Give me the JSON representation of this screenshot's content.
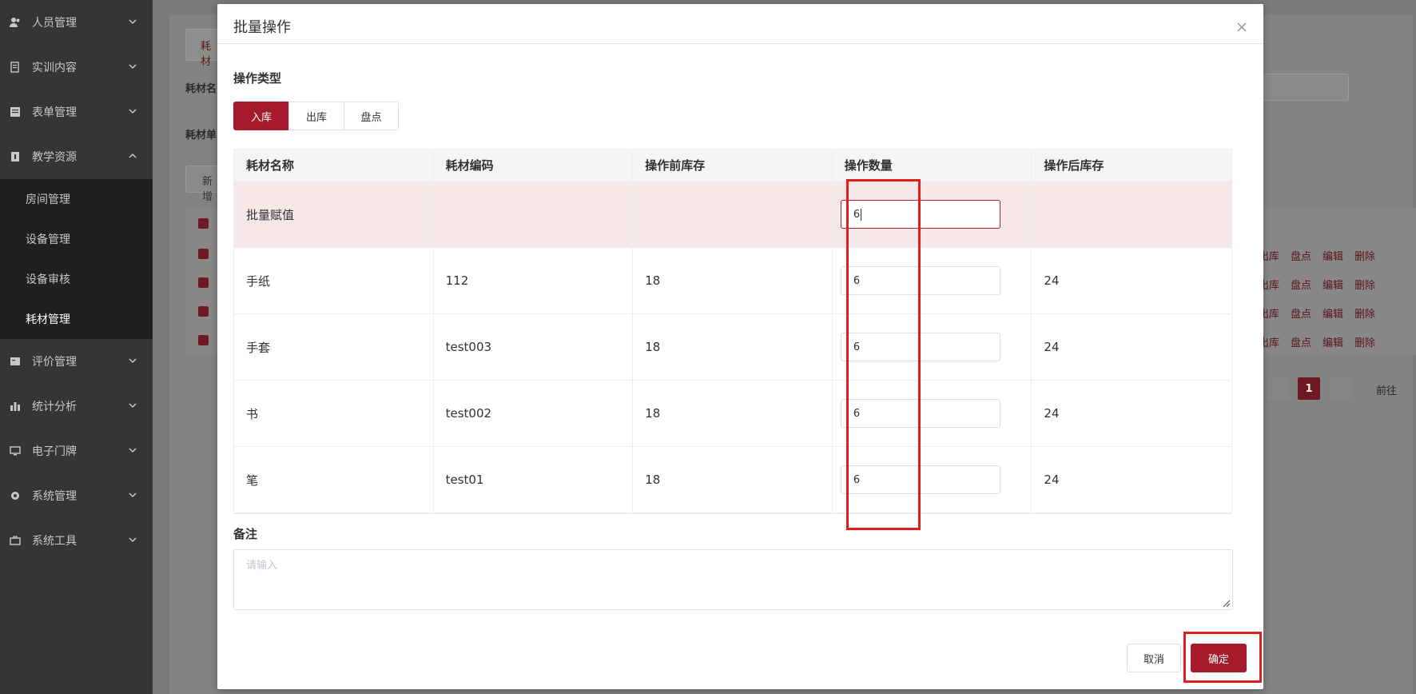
{
  "sidebar": {
    "items": [
      {
        "label": "人员管理",
        "icon": "user-icon"
      },
      {
        "label": "实训内容",
        "icon": "book-icon"
      },
      {
        "label": "表单管理",
        "icon": "form-icon"
      },
      {
        "label": "教学资源",
        "icon": "resource-icon"
      },
      {
        "label": "评价管理",
        "icon": "evaluate-icon"
      },
      {
        "label": "统计分析",
        "icon": "bar-chart-icon"
      },
      {
        "label": "电子门牌",
        "icon": "monitor-icon"
      },
      {
        "label": "系统管理",
        "icon": "gear-icon"
      },
      {
        "label": "系统工具",
        "icon": "toolbox-icon"
      }
    ],
    "submenu": [
      "房间管理",
      "设备管理",
      "设备审核",
      "耗材管理"
    ]
  },
  "background": {
    "tab_label": "耗材",
    "field_label_1": "耗材名",
    "field_label_2": "耗材单",
    "new_button": "新增",
    "row_actions": [
      "出库",
      "盘点",
      "编辑",
      "删除"
    ],
    "current_page": "1",
    "goto_label": "前往"
  },
  "dialog": {
    "title": "批量操作",
    "operation_type_label": "操作类型",
    "operation_types": [
      "入库",
      "出库",
      "盘点"
    ],
    "selected_operation": "入库",
    "table": {
      "headers": [
        "耗材名称",
        "耗材编码",
        "操作前库存",
        "操作数量",
        "操作后库存"
      ],
      "batch_row": {
        "name": "批量赋值",
        "code": "",
        "before": "",
        "quantity": "6",
        "after": ""
      },
      "rows": [
        {
          "name": "手纸",
          "code": "112",
          "before": "18",
          "quantity": "6",
          "after": "24"
        },
        {
          "name": "手套",
          "code": "test003",
          "before": "18",
          "quantity": "6",
          "after": "24"
        },
        {
          "name": "书",
          "code": "test002",
          "before": "18",
          "quantity": "6",
          "after": "24"
        },
        {
          "name": "笔",
          "code": "test01",
          "before": "18",
          "quantity": "6",
          "after": "24"
        }
      ]
    },
    "remark_label": "备注",
    "remark_placeholder": "请输入",
    "cancel_label": "取消",
    "confirm_label": "确定"
  },
  "colors": {
    "accent": "#a61b2b",
    "sidebar": "#353535",
    "annotation": "#e01f1f"
  }
}
